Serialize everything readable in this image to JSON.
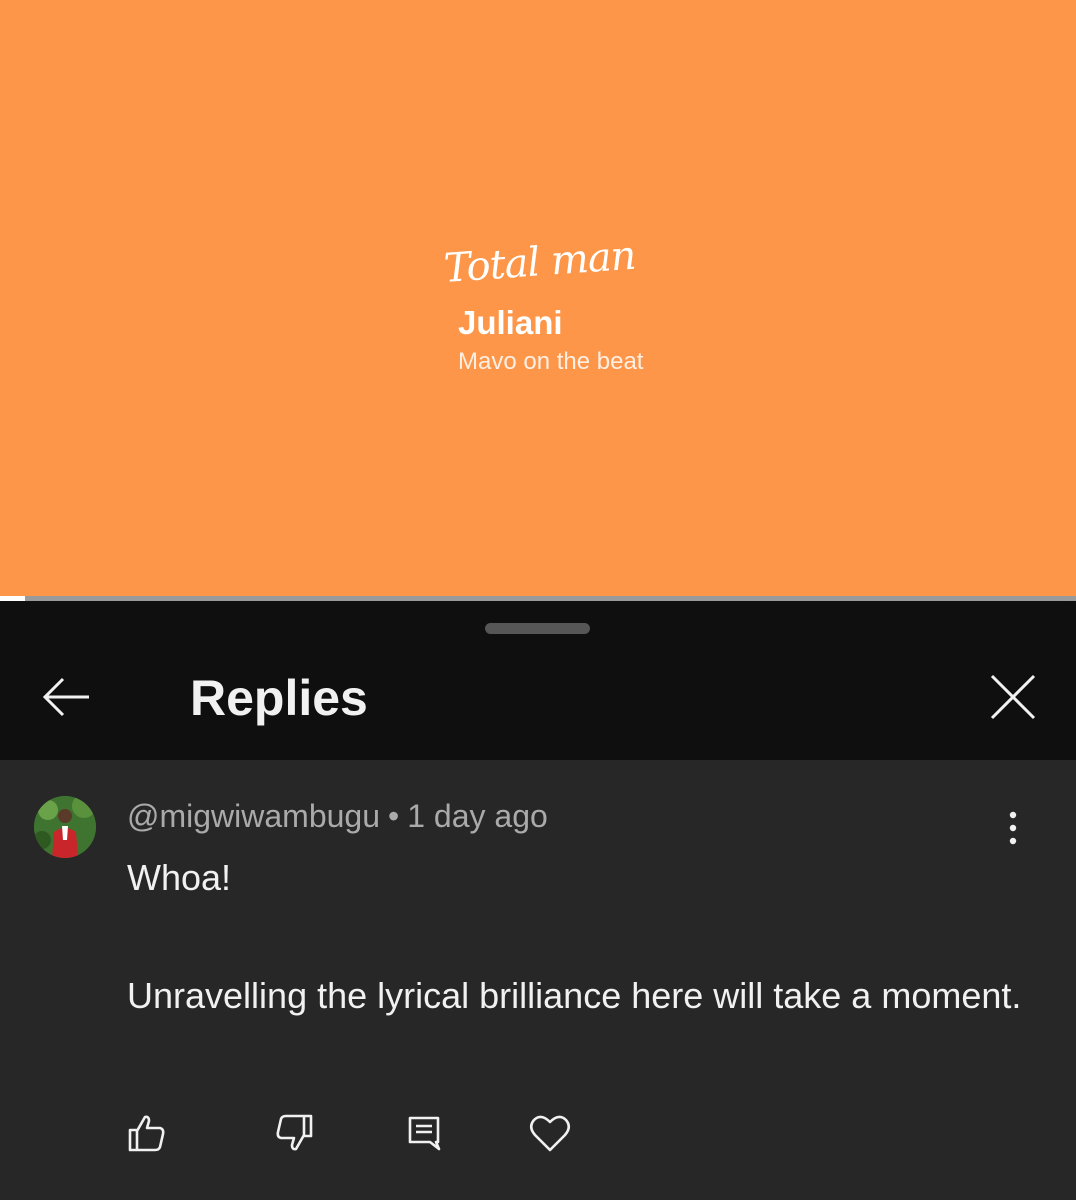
{
  "video": {
    "song_title": "Total man",
    "artist": "Juliani",
    "producer": "Mavo on the beat",
    "progress_fraction": 0.023
  },
  "sheet": {
    "title": "Replies",
    "back_icon": "arrow-left-icon",
    "close_icon": "close-icon"
  },
  "comment": {
    "author": "@migwiwambugu",
    "separator": "•",
    "timestamp": "1 day ago",
    "text": "Whoa!\n\nUnravelling the lyrical brilliance here will take a moment.",
    "menu_icon": "more-vert-icon",
    "actions": [
      {
        "name": "like-button",
        "icon": "thumb-up-icon"
      },
      {
        "name": "dislike-button",
        "icon": "thumb-down-icon"
      },
      {
        "name": "reply-button",
        "icon": "comment-icon"
      },
      {
        "name": "heart-button",
        "icon": "heart-icon"
      }
    ]
  },
  "colors": {
    "video_background": "#fd9648",
    "sheet_background": "#0f0f0f",
    "comment_background": "#272727",
    "text_primary": "#f1f1f1",
    "text_secondary": "#aaaaaa"
  }
}
